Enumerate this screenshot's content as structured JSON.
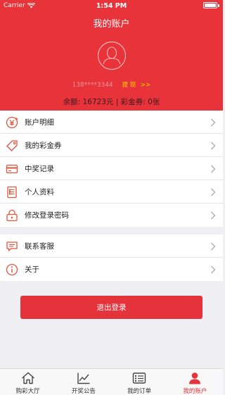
{
  "status_bar": {
    "carrier": "Carrier",
    "time": "1:54 PM"
  },
  "header": {
    "title": "我的账户",
    "phone": "138****3344",
    "withdraw_label": "提 现",
    "withdraw_arrow": ">>",
    "balance_label": "余额:",
    "balance_value": "16723元",
    "separator": "|",
    "coupon_label": "彩金券:",
    "coupon_value": "0张"
  },
  "menu_group_1": [
    {
      "label": "账户明细",
      "icon": "yen-circle-icon"
    },
    {
      "label": "我的彩金券",
      "icon": "tag-icon"
    },
    {
      "label": "中奖记录",
      "icon": "card-icon"
    },
    {
      "label": "个人资料",
      "icon": "profile-doc-icon"
    },
    {
      "label": "修改登录密码",
      "icon": "lock-icon"
    }
  ],
  "menu_group_2": [
    {
      "label": "联系客服",
      "icon": "chat-icon"
    },
    {
      "label": "关于",
      "icon": "info-icon"
    }
  ],
  "logout_label": "退出登录",
  "tabbar": [
    {
      "label": "购彩大厅",
      "icon": "home-icon",
      "active": false
    },
    {
      "label": "开奖公告",
      "icon": "trend-chart-icon",
      "active": false
    },
    {
      "label": "我的订单",
      "icon": "order-list-icon",
      "active": false
    },
    {
      "label": "我的账户",
      "icon": "user-icon",
      "active": true
    }
  ],
  "colors": {
    "brand_red": "#e8333a",
    "icon_orange": "#e5533b",
    "highlight_yellow": "#ffd400"
  }
}
